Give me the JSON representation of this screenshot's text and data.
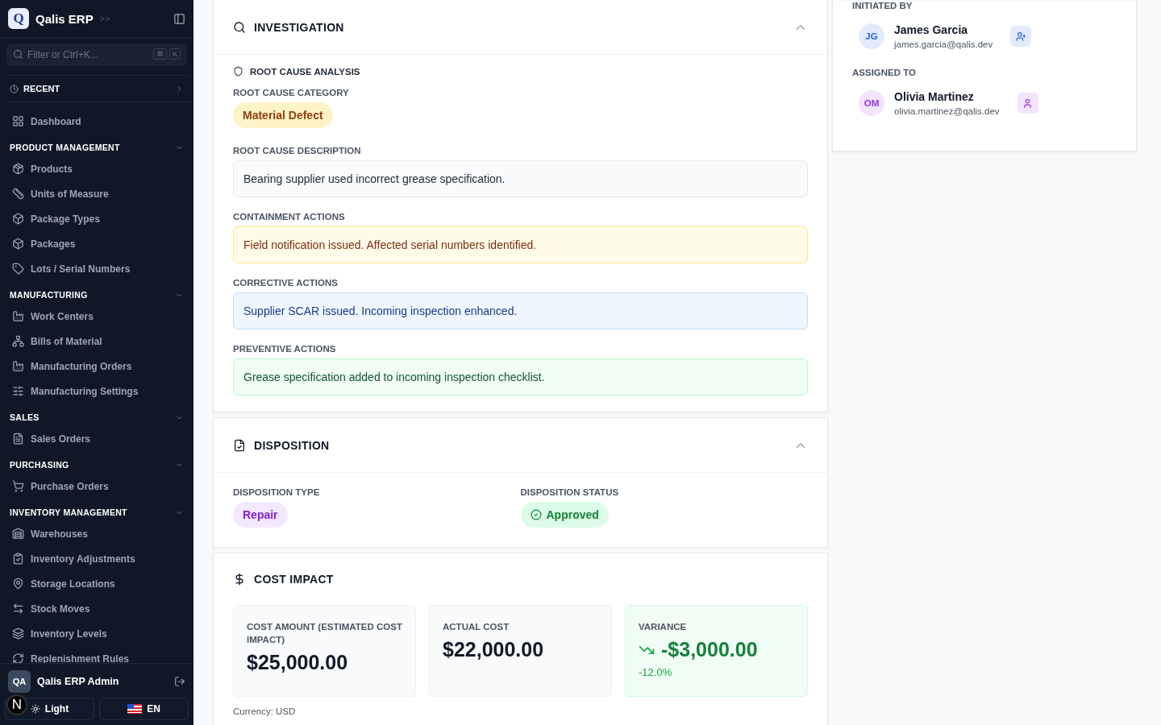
{
  "sidebar": {
    "brand": {
      "logo_letter": "Q",
      "name": "Qalis ERP",
      "expand_glyph": ">>"
    },
    "search": {
      "placeholder": "Filter or Ctrl+K...",
      "keys": [
        "⌘",
        "K"
      ]
    },
    "recent": {
      "label": "RECENT",
      "expanded": false
    },
    "top_items": [
      {
        "label": "Dashboard",
        "selected": false
      }
    ],
    "sections": [
      {
        "title": "PRODUCT MANAGEMENT",
        "expanded": true,
        "items": [
          {
            "label": "Products",
            "selected": false
          },
          {
            "label": "Units of Measure",
            "selected": false
          },
          {
            "label": "Package Types",
            "selected": false
          },
          {
            "label": "Packages",
            "selected": false
          },
          {
            "label": "Lots / Serial Numbers",
            "selected": false
          }
        ]
      },
      {
        "title": "MANUFACTURING",
        "expanded": true,
        "items": [
          {
            "label": "Work Centers",
            "selected": false
          },
          {
            "label": "Bills of Material",
            "selected": false
          },
          {
            "label": "Manufacturing Orders",
            "selected": false
          },
          {
            "label": "Manufacturing Settings",
            "selected": false
          }
        ]
      },
      {
        "title": "SALES",
        "expanded": true,
        "items": [
          {
            "label": "Sales Orders",
            "selected": false
          }
        ]
      },
      {
        "title": "PURCHASING",
        "expanded": true,
        "items": [
          {
            "label": "Purchase Orders",
            "selected": false
          }
        ]
      },
      {
        "title": "INVENTORY MANAGEMENT",
        "expanded": true,
        "items": [
          {
            "label": "Warehouses",
            "selected": false
          },
          {
            "label": "Inventory Adjustments",
            "selected": false
          },
          {
            "label": "Storage Locations",
            "selected": false
          },
          {
            "label": "Stock Moves",
            "selected": false
          },
          {
            "label": "Inventory Levels",
            "selected": false
          },
          {
            "label": "Replenishment Rules",
            "selected": false
          }
        ]
      }
    ],
    "user": {
      "initials": "QA",
      "name": "Qalis ERP Admin"
    },
    "dev_badge": "N",
    "theme_button": "Light",
    "language_button": "EN"
  },
  "investigation": {
    "title": "INVESTIGATION",
    "expanded": true,
    "subtitle": "ROOT CAUSE ANALYSIS",
    "category": {
      "label": "ROOT CAUSE CATEGORY",
      "value": "Material Defect"
    },
    "blocks": [
      {
        "label": "ROOT CAUSE DESCRIPTION",
        "text": "Bearing supplier used incorrect grease specification.",
        "kind": "neutral"
      },
      {
        "label": "CONTAINMENT ACTIONS",
        "text": "Field notification issued. Affected serial numbers identified.",
        "kind": "warning"
      },
      {
        "label": "CORRECTIVE ACTIONS",
        "text": "Supplier SCAR issued. Incoming inspection enhanced.",
        "kind": "info"
      },
      {
        "label": "PREVENTIVE ACTIONS",
        "text": "Grease specification added to incoming inspection checklist.",
        "kind": "success"
      }
    ]
  },
  "disposition": {
    "title": "DISPOSITION",
    "expanded": true,
    "type": {
      "label": "DISPOSITION TYPE",
      "value": "Repair"
    },
    "status": {
      "label": "DISPOSITION STATUS",
      "value": "Approved"
    }
  },
  "cost_impact": {
    "title": "COST IMPACT",
    "cards": [
      {
        "kind": "plain",
        "label": "COST AMOUNT (ESTIMATED COST IMPACT)",
        "value": "$25,000.00"
      },
      {
        "kind": "plain",
        "label": "ACTUAL COST",
        "value": "$22,000.00"
      },
      {
        "kind": "variance",
        "label": "VARIANCE",
        "value": "-$3,000.00",
        "note": "-12.0%"
      }
    ],
    "currency": "Currency: USD"
  },
  "people": [
    {
      "label": "INITIATED BY",
      "initials": "JG",
      "name": "James Garcia",
      "email": "james.garcia@qalis.dev",
      "color": "#2563eb"
    },
    {
      "label": "ASSIGNED TO",
      "initials": "OM",
      "name": "Olivia Martinez",
      "email": "olivia.martinez@qalis.dev",
      "color": "#9333ea"
    }
  ]
}
